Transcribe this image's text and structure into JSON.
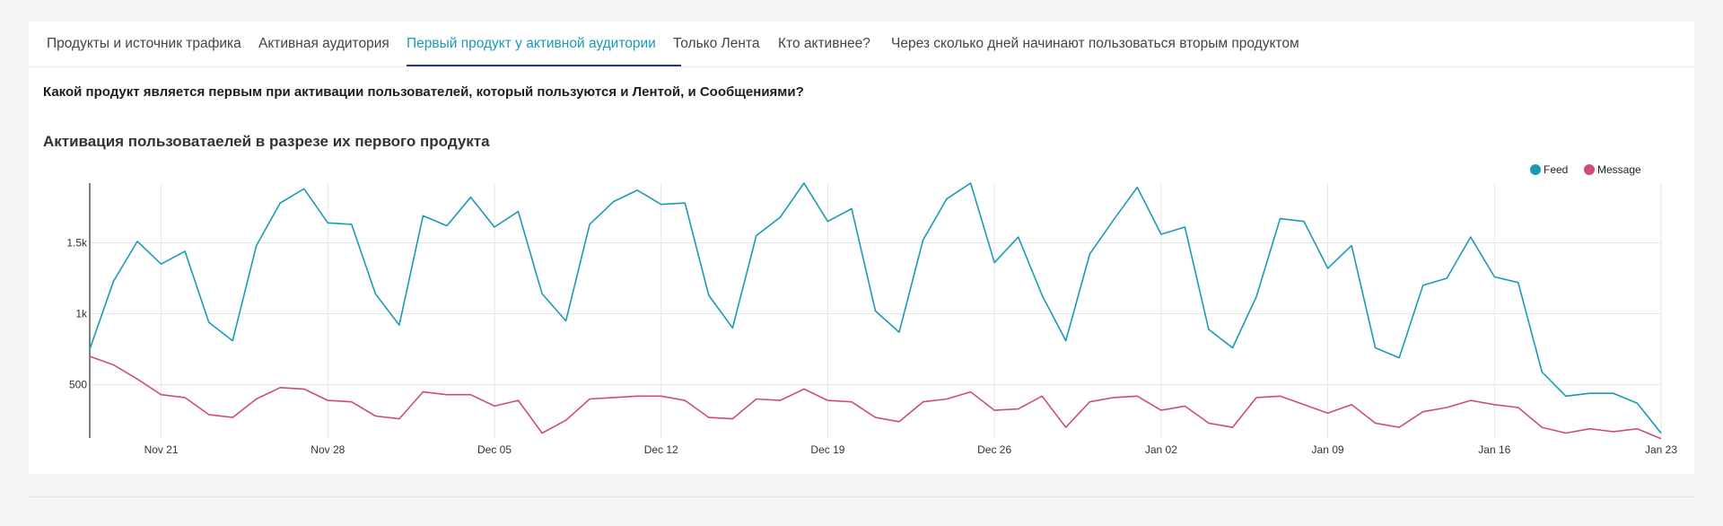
{
  "tabs": [
    {
      "label": "Продукты и источник трафика",
      "active": false
    },
    {
      "label": "Активная аудитория",
      "active": false
    },
    {
      "label": "Первый продукт у активной аудитории",
      "active": true
    },
    {
      "label": "Только Лента",
      "active": false
    },
    {
      "label": "Кто активнее?",
      "active": false
    },
    {
      "label": "Через сколько дней начинают пользоваться вторым продуктом",
      "active": false
    }
  ],
  "question": "Какой продукт является первым при активации пользователей, который пользуются и Лентой, и Сообщениями?",
  "chart_title": "Активация пользоватаелей в разрезе их первого продукта",
  "colors": {
    "feed": "#1a9ab5",
    "message": "#cc4d7a",
    "active_tab": "#1a9ab5",
    "underline": "#28357a"
  },
  "chart_data": {
    "type": "line",
    "title": "Активация пользоватаелей в разрезе их первого продукта",
    "xlabel": "",
    "ylabel": "",
    "x_start": "2022-11-18",
    "x_ticks": [
      "Nov 21",
      "Nov 28",
      "Dec 05",
      "Dec 12",
      "Dec 19",
      "Dec 26",
      "Jan 02",
      "Jan 09",
      "Jan 16",
      "Jan 23"
    ],
    "y_ticks": [
      "500",
      "1k",
      "1.5k"
    ],
    "ylim": [
      125,
      1920
    ],
    "grid": true,
    "legend_position": "top-right",
    "series": [
      {
        "name": "Feed",
        "color": "#1a9ab5",
        "values": [
          750,
          1230,
          1510,
          1350,
          1440,
          940,
          810,
          1480,
          1780,
          1880,
          1640,
          1630,
          1140,
          920,
          1690,
          1620,
          1820,
          1610,
          1720,
          1140,
          950,
          1630,
          1790,
          1870,
          1770,
          1780,
          1130,
          900,
          1550,
          1680,
          1920,
          1650,
          1740,
          1020,
          870,
          1520,
          1810,
          1920,
          1360,
          1540,
          1130,
          810,
          1420,
          1660,
          1890,
          1560,
          1610,
          890,
          760,
          1120,
          1670,
          1650,
          1320,
          1480,
          760,
          690,
          1200,
          1250,
          1540,
          1260,
          1220,
          590,
          420,
          440,
          440,
          370,
          160
        ]
      },
      {
        "name": "Message",
        "color": "#cc4d7a",
        "values": [
          700,
          640,
          540,
          430,
          410,
          290,
          270,
          400,
          480,
          470,
          390,
          380,
          280,
          260,
          450,
          430,
          430,
          350,
          390,
          160,
          250,
          400,
          410,
          420,
          420,
          390,
          270,
          260,
          400,
          390,
          470,
          390,
          380,
          270,
          240,
          380,
          400,
          450,
          320,
          330,
          420,
          200,
          380,
          410,
          420,
          320,
          350,
          230,
          200,
          410,
          420,
          360,
          300,
          360,
          230,
          200,
          310,
          340,
          390,
          360,
          340,
          200,
          160,
          190,
          170,
          190,
          120
        ]
      }
    ]
  }
}
